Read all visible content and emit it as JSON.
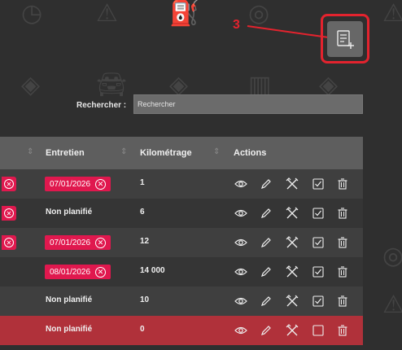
{
  "annotation": {
    "step": "3"
  },
  "header": {
    "add_icon": "add-list-icon"
  },
  "search": {
    "label": "Rechercher :",
    "placeholder": "Rechercher"
  },
  "table": {
    "columns": [
      "Entretien",
      "Kilométrage",
      "Actions"
    ],
    "rows": [
      {
        "entretien": "07/01/2026",
        "km": "1",
        "overdue": true,
        "left_badge": true
      },
      {
        "entretien": "Non planifié",
        "km": "6",
        "overdue": false,
        "left_badge": true
      },
      {
        "entretien": "07/01/2026",
        "km": "12",
        "overdue": true,
        "left_badge": true
      },
      {
        "entretien": "08/01/2026",
        "km": "14 000",
        "overdue": true,
        "left_badge": false
      },
      {
        "entretien": "Non planifié",
        "km": "10",
        "overdue": false,
        "left_badge": false
      },
      {
        "entretien": "Non planifié",
        "km": "0",
        "overdue": false,
        "left_badge": false,
        "selected": true
      }
    ],
    "action_icons": [
      "eye-icon",
      "pencil-icon",
      "tools-icon",
      "checkbox-icon",
      "trash-icon"
    ]
  },
  "colors": {
    "accent": "#e0184e",
    "annotation": "#e3232e",
    "selected_row": "#b0313a"
  }
}
